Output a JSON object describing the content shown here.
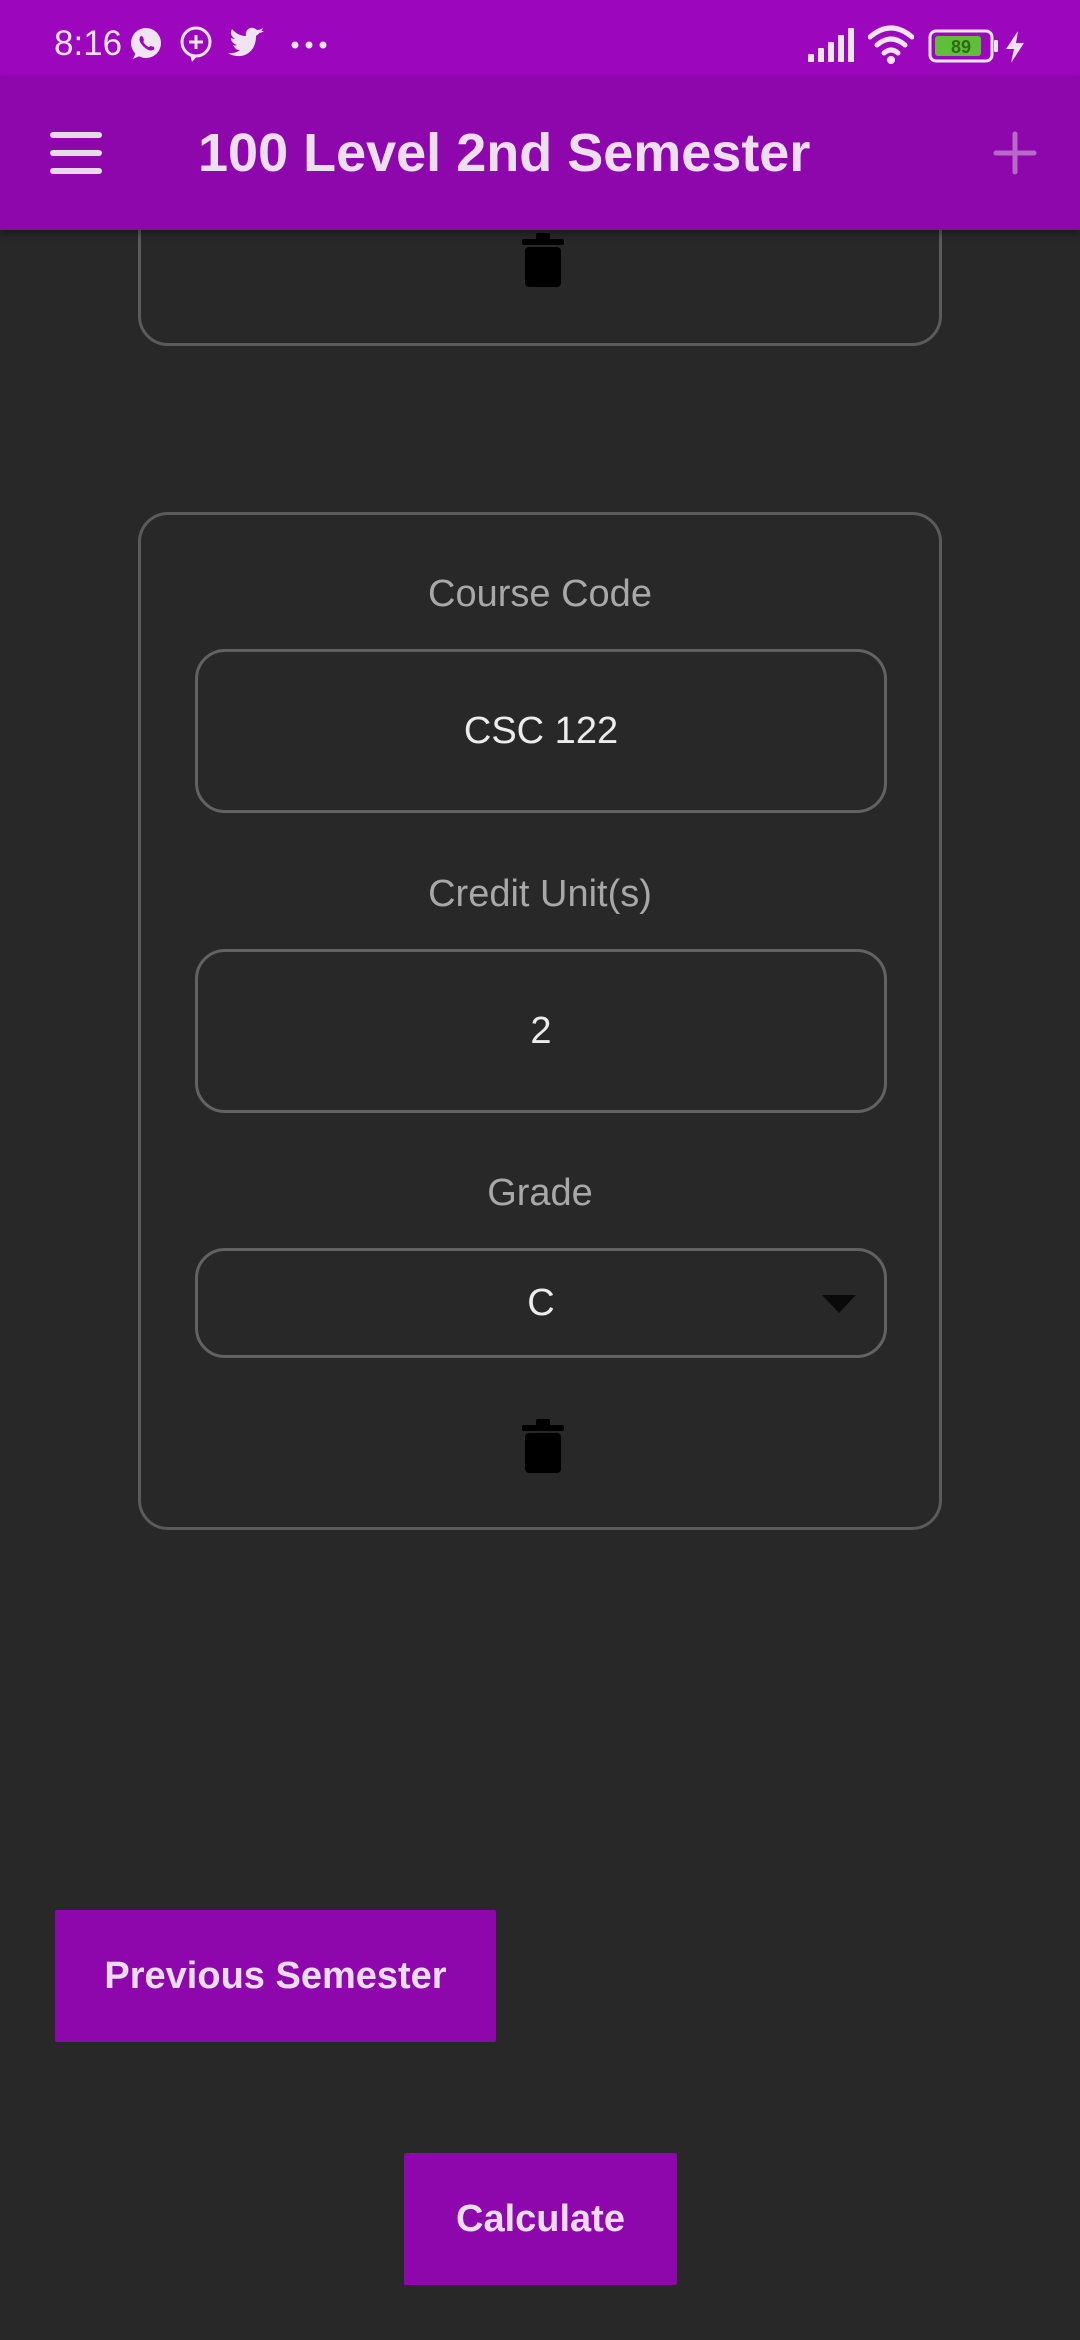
{
  "status_bar": {
    "time": "8:16",
    "notification_icons": [
      "whatsapp-icon",
      "chat-plus-icon",
      "twitter-icon",
      "more-dots-icon"
    ],
    "system_icons": [
      "signal-icon",
      "wifi-icon",
      "battery-icon",
      "charging-icon"
    ],
    "battery_level": "89"
  },
  "app_bar": {
    "title": "100 Level 2nd Semester",
    "menu_icon": "hamburger-menu-icon",
    "add_icon": "plus-icon"
  },
  "course_card": {
    "course_code_label": "Course Code",
    "course_code_value": "CSC 122",
    "credit_units_label": "Credit Unit(s)",
    "credit_units_value": "2",
    "grade_label": "Grade",
    "grade_value": "C"
  },
  "actions": {
    "previous_semester": "Previous Semester",
    "calculate": "Calculate"
  },
  "colors": {
    "status_bar": "#9c07bd",
    "app_bar": "#8e07ac",
    "background": "#282828",
    "button": "#8e07ac"
  }
}
